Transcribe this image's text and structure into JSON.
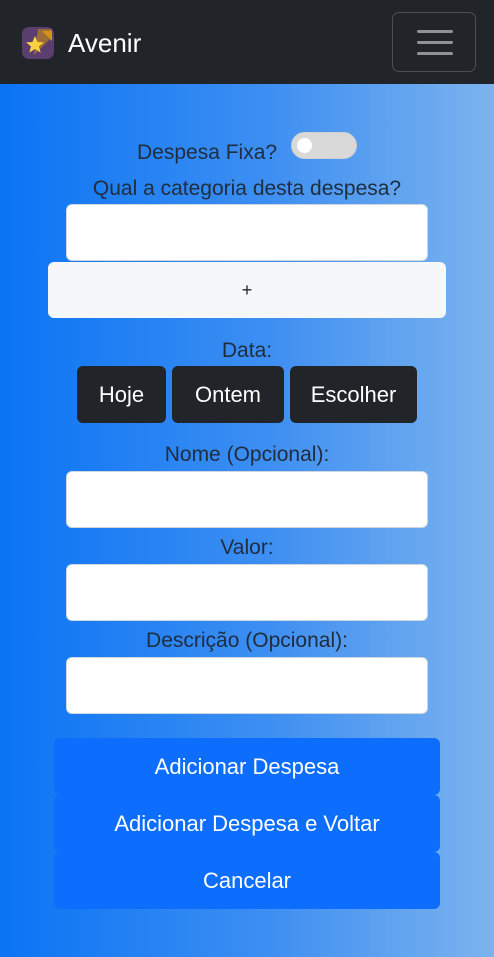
{
  "navbar": {
    "brand": "Avenir",
    "logo_icon": "shooting-star-icon",
    "menu_icon": "hamburger-icon"
  },
  "form": {
    "fixed_label": "Despesa Fixa?",
    "fixed_checked": false,
    "category_label": "Qual a categoria desta despesa?",
    "category_value": "",
    "add_category_label": "+",
    "date_label": "Data:",
    "date_buttons": [
      "Hoje",
      "Ontem",
      "Escolher"
    ],
    "name_label": "Nome (Opcional):",
    "name_value": "",
    "value_label": "Valor:",
    "value_value": "",
    "description_label": "Descrição (Opcional):",
    "description_value": ""
  },
  "actions": {
    "add": "Adicionar Despesa",
    "add_and_back": "Adicionar Despesa e Voltar",
    "cancel": "Cancelar"
  },
  "colors": {
    "navbar": "#212529",
    "primary": "#0d6efd",
    "dark_button": "#212529",
    "gradient_start": "#0a74f4",
    "gradient_end": "#7cb3ee"
  }
}
